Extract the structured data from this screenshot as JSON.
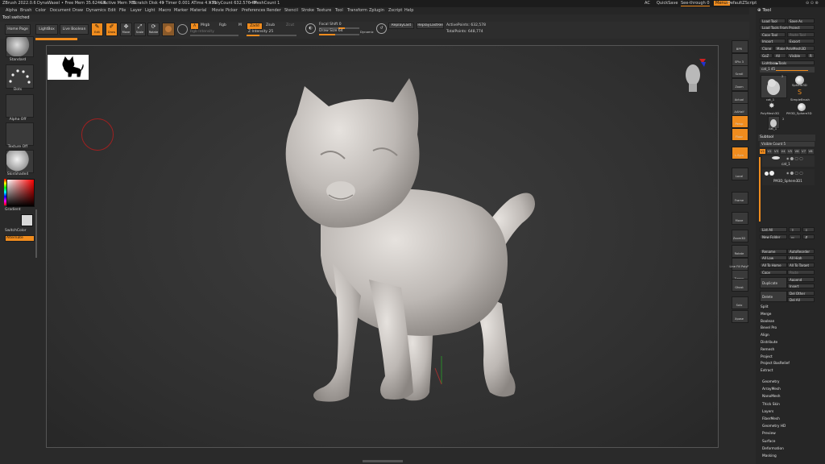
{
  "titlebar": {
    "app_name": "ZBrush 2022.0.6",
    "project": "DynaWaxel",
    "free_mem": "• Free Mem 35.624GB",
    "active_mem": "• Active Mem 785",
    "scratch_disk": "• Scratch Disk 49",
    "timer": "• Timer 0.001 ATime 4.933",
    "poly_count": "• PolyCount 632.576 KP",
    "mesh_count": "• MeshCount 1",
    "ac": "AC",
    "quicksave": "QuickSave",
    "see_through": "See-through 0",
    "menus": "Menus",
    "default_zscript": "DefaultZScript"
  },
  "menubar": {
    "items": [
      "Alpha",
      "Brush",
      "Color",
      "Document",
      "Draw",
      "Dynamics",
      "Edit",
      "File",
      "Layer",
      "Light",
      "Macro",
      "Marker",
      "Material",
      "Movie",
      "Picker",
      "Preferences",
      "Render",
      "Stencil",
      "Stroke",
      "Texture",
      "Tool",
      "Transform",
      "Zplugin",
      "Zscript",
      "Help"
    ]
  },
  "status": {
    "message": "Tool switched"
  },
  "shelf": {
    "home_page": "Home Page",
    "lightbox": "LightBox",
    "live_boolean": "Live Boolean",
    "edit": "Edit",
    "draw": "Draw",
    "move": "Move",
    "scale": "Scale",
    "rotate": "Rotate",
    "a_label": "A",
    "mrgb": "Mrgb",
    "rgb": "Rgb",
    "m": "M",
    "zadd": "Zadd",
    "zsub": "Zsub",
    "zcut": "Zcut",
    "rgb_intensity": "Rgb Intensity",
    "z_intensity": "Z Intensity 25",
    "z_intensity_value": 0.25,
    "focal_shift": "Focal Shift 0",
    "draw_size": "Draw Size 64",
    "dynamic": "Dynamic",
    "replay_last": "ReplayLast",
    "replay_last_rel": "ReplayLastRel",
    "active_points": "ActivePoints: 632,578",
    "total_points": "TotalPoints: 648,774"
  },
  "left_panel": {
    "brush_name": "Standard",
    "stroke_name": "Dots",
    "alpha_name": "Alpha Off",
    "texture_name": "Texture Off",
    "material_name": "SkinShade4",
    "gradient": "Gradient",
    "switch_color": "SwitchColor",
    "alternate": "Alternate"
  },
  "right_toolbar": {
    "buttons": [
      "BPR",
      "SPix 3",
      "Scroll",
      "Zoom",
      "Actual",
      "AAHalf",
      "Persp",
      "Floor",
      "L.Sym",
      "Local",
      "Frame",
      "Move",
      "Zoom3D",
      "Rotate",
      "Line Fill PolyF",
      "Transp",
      "Ghost",
      "Solo",
      "Xpose"
    ]
  },
  "tool_palette": {
    "title": "Tool",
    "load_tool": "Load Tool",
    "save_as": "Save As",
    "load_tools_from_project": "Load Tools From Project",
    "copy_tool": "Copy Tool",
    "paste_tool": "Paste Tool",
    "import": "Import",
    "export": "Export",
    "clone": "Clone",
    "make_polymesh3d": "Make PolyMesh3D",
    "goz": "GoZ",
    "all": "All",
    "visible": "Visible",
    "r": "R",
    "lightbox_tools": "Lightbox▶Tools",
    "current_tool": "cat_1",
    "current_tool_count": "45",
    "tools": [
      {
        "name": "cat_1",
        "count": "2"
      },
      {
        "name": "Sphere3D",
        "count": ""
      },
      {
        "name": "cat_1",
        "count": ""
      },
      {
        "name": "SimpleBrush",
        "count": ""
      },
      {
        "name": "PolyMesh3D",
        "count": ""
      },
      {
        "name": "PM3D_Sphere3D",
        "count": ""
      },
      {
        "name": "cat_1",
        "count": "2"
      }
    ],
    "subtool_header": "Subtool",
    "visible_count": "Visible Count 5",
    "subtool_tabs": [
      "V1",
      "V2",
      "V3",
      "V4",
      "V5",
      "V6",
      "V7",
      "V8"
    ],
    "subtools": [
      "cat_1",
      "PM3D_Sphere3D1"
    ],
    "list_all": "List All",
    "new_folder": "New Folder",
    "rename": "Rename",
    "autoreorder": "AutoReorder",
    "all_low": "All Low",
    "all_high": "All High",
    "all_to_home": "All To Home",
    "all_to_target": "All To Target",
    "copy": "Copy",
    "paste": "Paste",
    "duplicate": "Duplicate",
    "append": "Append",
    "insert": "Insert",
    "delete": "Delete",
    "del_other": "Del Other",
    "del_all": "Del All",
    "sections": [
      "Split",
      "Merge",
      "Boolean",
      "Bevel Pro",
      "Align",
      "Distribute",
      "Remesh",
      "Project",
      "Project BasRelief",
      "Extract"
    ],
    "sub_palettes": [
      "Geometry",
      "ArrayMesh",
      "NanoMesh",
      "Thick Skin",
      "Layers",
      "FiberMesh",
      "Geometry HD",
      "Preview",
      "Surface",
      "Deformation",
      "Masking"
    ]
  },
  "colors": {
    "accent": "#f08c1e",
    "background": "#2a2a2a",
    "model": "#bdb8b4"
  }
}
